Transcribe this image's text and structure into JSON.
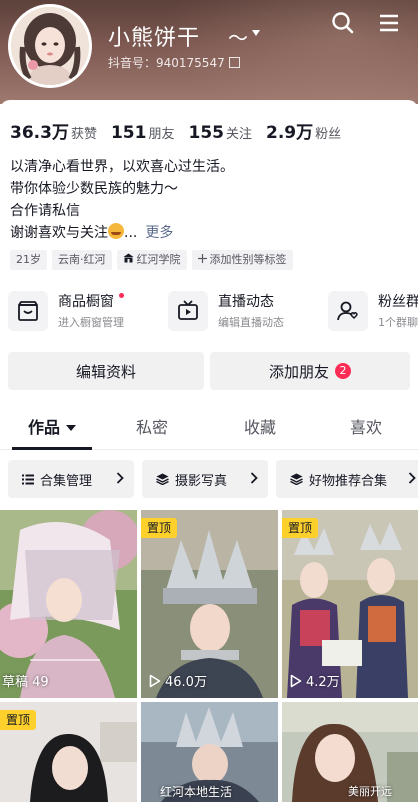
{
  "profile": {
    "nickname": "小熊饼干",
    "nickname_suffix": "～",
    "douyin_id": "抖音号：940175547"
  },
  "header_icons": [
    "search-icon",
    "menu-icon"
  ],
  "stats": [
    {
      "value": "36.3万",
      "label": "获赞"
    },
    {
      "value": "151",
      "label": "朋友"
    },
    {
      "value": "155",
      "label": "关注"
    },
    {
      "value": "2.9万",
      "label": "粉丝"
    }
  ],
  "bio": {
    "lines": [
      "以清净心看世界，以欢喜心过生活。",
      "带你体验少数民族的魅力～",
      "合作请私信"
    ],
    "last_line": "谢谢喜欢与关注",
    "last_line_suffix": "...",
    "more": "更多"
  },
  "tags": [
    {
      "text": "21岁"
    },
    {
      "text": "云南·红河"
    },
    {
      "text": "红河学院"
    },
    {
      "text": "添加性别等标签"
    }
  ],
  "features": [
    {
      "title": "商品橱窗",
      "subtitle": "进入橱窗管理",
      "icon": "shop-window-icon"
    },
    {
      "title": "直播动态",
      "subtitle": "编辑直播动态",
      "icon": "live-tv-icon"
    },
    {
      "title": "粉丝群",
      "subtitle": "1个群聊",
      "icon": "fan-group-icon"
    }
  ],
  "buttons": {
    "edit_profile": "编辑资料",
    "add_friend": "添加朋友",
    "add_friend_badge": "2"
  },
  "tabs": [
    {
      "label": "作品",
      "active": true
    },
    {
      "label": "私密",
      "active": false
    },
    {
      "label": "收藏",
      "active": false
    },
    {
      "label": "喜欢",
      "active": false
    }
  ],
  "chips": [
    {
      "label": "合集管理",
      "icon": "list-icon"
    },
    {
      "label": "摄影写真",
      "icon": "stack-icon"
    },
    {
      "label": "好物推荐合集",
      "icon": "stack-icon"
    }
  ],
  "videos": [
    {
      "pinned": false,
      "draft_label": "草稿 49",
      "views": ""
    },
    {
      "pinned": true,
      "pin_label": "置顶",
      "views": "46.0万"
    },
    {
      "pinned": true,
      "pin_label": "置顶",
      "views": "4.2万"
    },
    {
      "pinned": true,
      "pin_label": "置顶",
      "views": ""
    },
    {
      "pinned": false,
      "views": ""
    },
    {
      "pinned": false,
      "views": ""
    }
  ],
  "watermark": "红河本地生活",
  "watermark_corner": "美丽开远",
  "colors": {
    "accent_red": "#fe2c55",
    "pin_yellow": "#fdd02b",
    "header_brown": "#8a625a"
  }
}
